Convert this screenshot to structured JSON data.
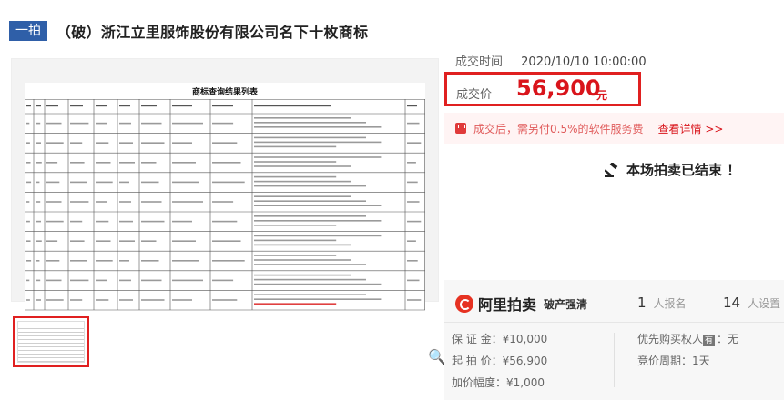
{
  "header": {
    "badge": "一拍",
    "title": "（破）浙江立里服饰股份有限公司名下十枚商标"
  },
  "document": {
    "title": "商标查询结果列表",
    "row_count": 10
  },
  "deal": {
    "time_label": "成交时间",
    "time_value": "2020/10/10 10:00:00",
    "price_label": "成交价",
    "price_value": "56,900",
    "price_unit": "元"
  },
  "fee": {
    "text": "成交后，需另付0.5%的软件服务费",
    "link": "查看详情 >>"
  },
  "status": {
    "ended_text": "本场拍卖已结束 ！"
  },
  "platform": {
    "name": "阿里拍卖",
    "tag": "破产强清",
    "signup_count": "1",
    "signup_label": "人报名",
    "watch_count": "14",
    "watch_label": "人设置"
  },
  "details": {
    "deposit": "保 证 金：¥10,000",
    "start_price": "起 拍 价：¥56,900",
    "increment": "加价幅度：¥1,000",
    "priority_badge": "有",
    "priority_label": "优先购买权人",
    "priority_value": "：无",
    "bid_period": "竞价周期：1天"
  },
  "colors": {
    "accent": "#d9141b",
    "badge": "#2f5fa8",
    "highlight_border": "#e02020"
  }
}
